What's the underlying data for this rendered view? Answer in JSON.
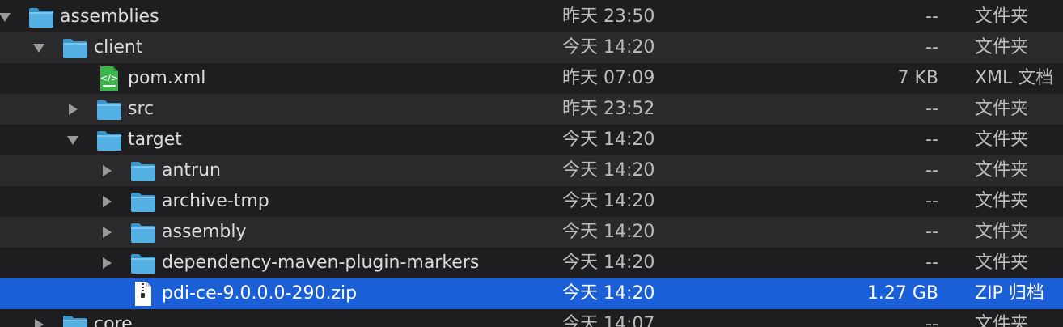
{
  "files": [
    {
      "name": "assemblies",
      "date": "昨天 23:50",
      "size": "--",
      "kind": "文件夹",
      "icon": "folder-icon",
      "disclosure": "expanded"
    },
    {
      "name": "client",
      "date": "今天 14:20",
      "size": "--",
      "kind": "文件夹",
      "icon": "folder-icon",
      "disclosure": "expanded"
    },
    {
      "name": "pom.xml",
      "date": "昨天 07:09",
      "size": "7 KB",
      "kind": "XML 文档",
      "icon": "xml-file-icon",
      "disclosure": "none"
    },
    {
      "name": "src",
      "date": "昨天 23:52",
      "size": "--",
      "kind": "文件夹",
      "icon": "folder-icon",
      "disclosure": "collapsed"
    },
    {
      "name": "target",
      "date": "今天 14:20",
      "size": "--",
      "kind": "文件夹",
      "icon": "folder-icon",
      "disclosure": "expanded"
    },
    {
      "name": "antrun",
      "date": "今天 14:20",
      "size": "--",
      "kind": "文件夹",
      "icon": "folder-icon",
      "disclosure": "collapsed"
    },
    {
      "name": "archive-tmp",
      "date": "今天 14:20",
      "size": "--",
      "kind": "文件夹",
      "icon": "folder-icon",
      "disclosure": "collapsed"
    },
    {
      "name": "assembly",
      "date": "今天 14:20",
      "size": "--",
      "kind": "文件夹",
      "icon": "folder-icon",
      "disclosure": "collapsed"
    },
    {
      "name": "dependency-maven-plugin-markers",
      "date": "今天 14:20",
      "size": "--",
      "kind": "文件夹",
      "icon": "folder-icon",
      "disclosure": "collapsed"
    },
    {
      "name": "pdi-ce-9.0.0.0-290.zip",
      "date": "今天 14:20",
      "size": "1.27 GB",
      "kind": "ZIP 归档",
      "icon": "zip-file-icon",
      "disclosure": "none",
      "selected": true
    },
    {
      "name": "core",
      "date": "今天 14:07",
      "size": "--",
      "kind": "文件夹",
      "icon": "folder-icon",
      "disclosure": "collapsed"
    }
  ],
  "colors": {
    "selection": "#1b5fd8",
    "folder": "#4aa6d9",
    "xml_icon": "#3bb54a"
  }
}
